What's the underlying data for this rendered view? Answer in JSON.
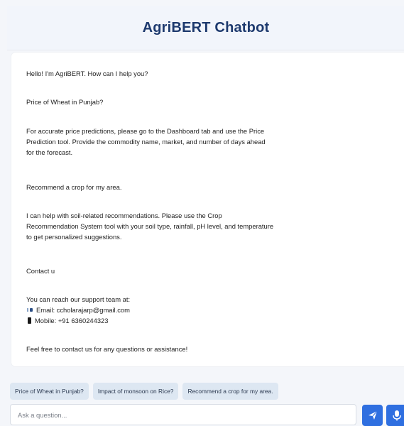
{
  "header": {
    "title": "AgriBERT Chatbot"
  },
  "chat": {
    "messages": [
      {
        "role": "bot",
        "lines": [
          "Hello! I'm AgriBERT. How can I help you?"
        ]
      },
      {
        "role": "user",
        "lines": [
          "Price of Wheat in Punjab?"
        ]
      },
      {
        "role": "bot",
        "lines": [
          "For accurate price predictions, please go to the Dashboard tab and use the Price",
          "Prediction tool. Provide the commodity name, market, and number of days ahead",
          "for the forecast."
        ]
      },
      {
        "role": "user",
        "lines": [
          "Recommend a crop for my area."
        ]
      },
      {
        "role": "bot",
        "lines": [
          "I can help with soil-related recommendations. Please use the Crop",
          "Recommendation System tool with your soil type, rainfall, pH level, and temperature",
          "to get personalized suggestions."
        ]
      },
      {
        "role": "user",
        "lines": [
          "Contact u"
        ]
      },
      {
        "role": "bot",
        "intro": "You can reach our support team at:",
        "email": "Email: ccholarajarp@gmail.com",
        "mobile": "Mobile: +91 6360244323",
        "email_icon": "email-icon",
        "mobile_icon": "mobile-phone-icon"
      },
      {
        "role": "bot",
        "lines": [
          "Feel free to contact us for any questions or assistance!"
        ]
      }
    ]
  },
  "suggestions": [
    "Price of Wheat in Punjab?",
    "Impact of monsoon on Rice?",
    "Recommend a crop for my area."
  ],
  "input": {
    "placeholder": "Ask a question...",
    "value": ""
  },
  "buttons": {
    "send_icon": "send-icon",
    "mic_icon": "microphone-icon"
  },
  "colors": {
    "title": "#1e3a6e",
    "accent": "#2f6fe0",
    "chip_bg": "#dde7f2",
    "page_bg": "#f4f6fa"
  }
}
